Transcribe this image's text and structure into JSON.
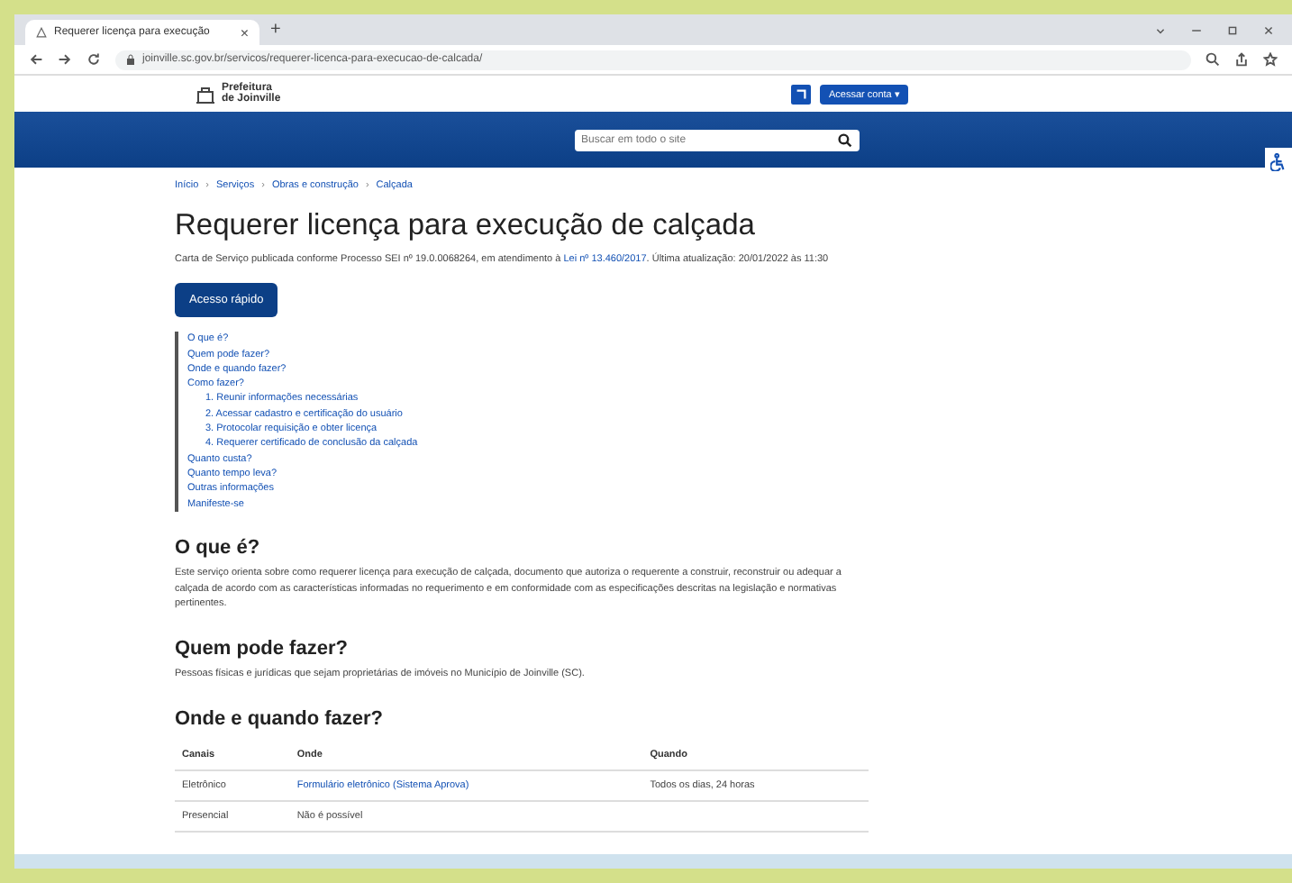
{
  "browser": {
    "tab_title": "Requerer licença para execução",
    "tab_close": "×",
    "new_tab": "+",
    "url": "joinville.sc.gov.br/servicos/requerer-licenca-para-execucao-de-calcada/"
  },
  "header": {
    "logo_text": "Prefeitura de Joinville",
    "account_button": "Acessar conta ▾",
    "search_placeholder": "Buscar em todo o site"
  },
  "breadcrumb": [
    "Início",
    "Serviços",
    "Obras e construção",
    "Calçada"
  ],
  "breadcrumb_separator": "›",
  "title": "Requerer licença para execução de calçada",
  "description": {
    "before": "Carta de Serviço publicada conforme Processo SEI nº 19.0.0068264, em atendimento à ",
    "link": "Lei nº 13.460/2017",
    "after": ". Última atualização: 20/01/2022 às 11:30"
  },
  "quick_access_button": "Acesso rápido",
  "toc": [
    {
      "label": "O que é?"
    },
    {
      "label": "Quem pode fazer?"
    },
    {
      "label": "Onde e quando fazer?"
    },
    {
      "label": "Como fazer?",
      "children": [
        {
          "label": "1. Reunir informações necessárias"
        },
        {
          "label": "2. Acessar cadastro e certificação do usuário"
        },
        {
          "label": "3. Protocolar requisição e obter licença"
        },
        {
          "label": "4. Requerer certificado de conclusão da calçada"
        }
      ]
    },
    {
      "label": "Quanto custa?"
    },
    {
      "label": "Quanto tempo leva?"
    },
    {
      "label": "Outras informações"
    },
    {
      "label": "Manifeste-se"
    }
  ],
  "sections": [
    {
      "heading": "O que é?",
      "text": "Este serviço orienta sobre como requerer licença para execução de calçada, documento que autoriza o requerente a construir, reconstruir ou adequar a calçada de acordo com as características informadas no requerimento e em conformidade com as especificações descritas na legislação e normativas pertinentes."
    },
    {
      "heading": "Quem pode fazer?",
      "text": "Pessoas físicas e jurídicas que sejam proprietárias de imóveis no Município de Joinville (SC)."
    }
  ],
  "channels": {
    "heading": "Onde e quando fazer?",
    "columns": [
      "Canais",
      "Onde",
      "Quando"
    ],
    "rows": [
      {
        "channel": "Eletrônico",
        "where": "Formulário eletrônico (Sistema Aprova)",
        "where_is_link": true,
        "when": "Todos os dias, 24 horas"
      },
      {
        "channel": "Presencial",
        "where": "Não é possível",
        "where_is_link": false
      }
    ]
  }
}
